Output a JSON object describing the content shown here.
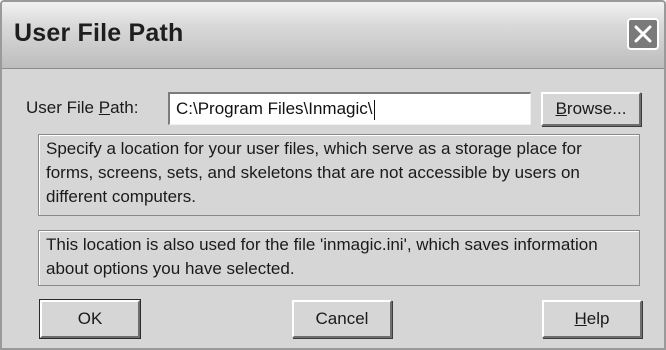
{
  "window": {
    "title": "User File Path",
    "close_icon": "close-icon"
  },
  "path_row": {
    "label_prefix": "User File ",
    "label_mnemonic": "P",
    "label_suffix": "ath:",
    "value": "C:\\Program Files\\Inmagic\\",
    "browse_mnemonic": "B",
    "browse_rest": "rowse..."
  },
  "info": {
    "description": "Specify a location for your user files, which serve as a storage place for forms, screens, sets, and skeletons that are not accessible by users on different computers.",
    "ini_note": "This location is also used for the file 'inmagic.ini', which saves information about options you have selected."
  },
  "buttons": {
    "ok": "OK",
    "cancel": "Cancel",
    "help_mnemonic": "H",
    "help_rest": "elp"
  }
}
